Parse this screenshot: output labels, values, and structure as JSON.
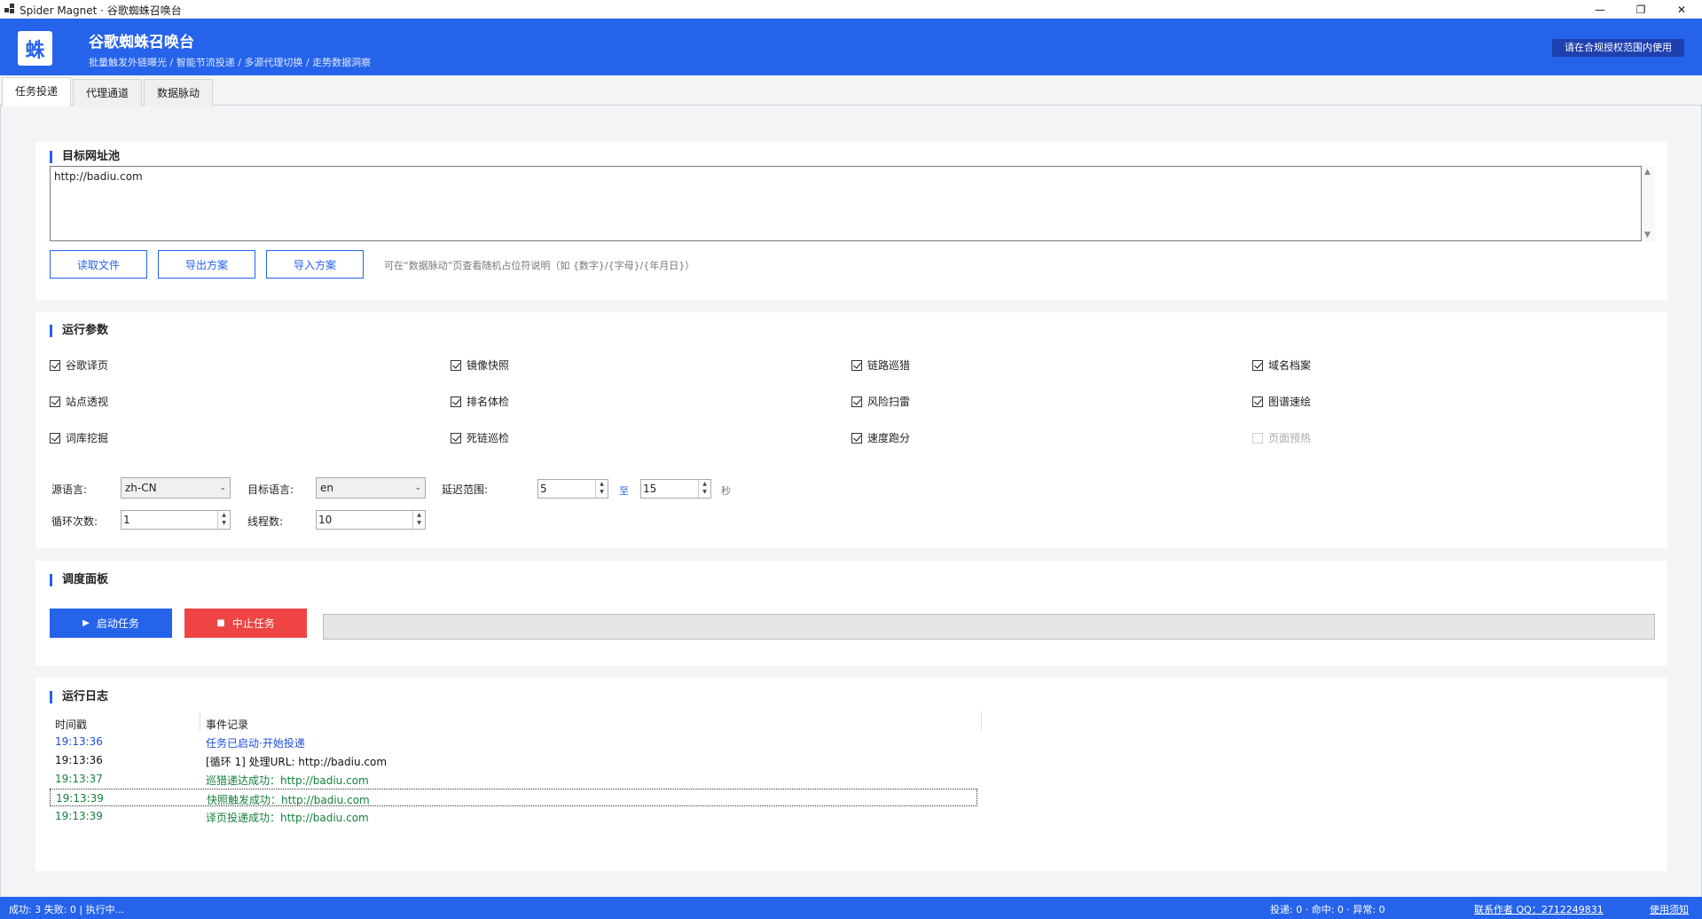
{
  "window": {
    "title": "Spider Magnet · 谷歌蜘蛛召唤台",
    "controls": {
      "minimize": "—",
      "restore": "❐",
      "close": "✕"
    }
  },
  "header": {
    "logo": "蛛",
    "title": "谷歌蜘蛛召唤台",
    "subtitle": "批量触发外链曝光 / 智能节流投递 / 多源代理切换 / 走势数据洞察",
    "notice": "请在合规授权范围内使用"
  },
  "tabs": [
    {
      "label": "任务投递",
      "active": true
    },
    {
      "label": "代理通道",
      "active": false
    },
    {
      "label": "数据脉动",
      "active": false
    }
  ],
  "url_pool": {
    "title": "目标网址池",
    "value": "http://badiu.com",
    "buttons": {
      "read_file": "读取文件",
      "export": "导出方案",
      "import": "导入方案"
    },
    "hint": "可在“数据脉动”页查看随机占位符说明（如 {数字}/{字母}/{年月日}）"
  },
  "params": {
    "title": "运行参数",
    "checkboxes": [
      {
        "label": "谷歌译页",
        "checked": true
      },
      {
        "label": "镜像快照",
        "checked": true
      },
      {
        "label": "链路巡猎",
        "checked": true
      },
      {
        "label": "域名档案",
        "checked": true
      },
      {
        "label": "站点透视",
        "checked": true
      },
      {
        "label": "排名体检",
        "checked": true
      },
      {
        "label": "风险扫雷",
        "checked": true
      },
      {
        "label": "图谱速绘",
        "checked": true
      },
      {
        "label": "词库挖掘",
        "checked": true
      },
      {
        "label": "死链巡检",
        "checked": true
      },
      {
        "label": "速度跑分",
        "checked": true
      },
      {
        "label": "页面预热",
        "checked": false,
        "disabled": true
      }
    ],
    "source_lang_label": "源语言:",
    "source_lang": "zh-CN",
    "target_lang_label": "目标语言:",
    "target_lang": "en",
    "delay_label": "延迟范围:",
    "delay_min": "5",
    "delay_to": "至",
    "delay_max": "15",
    "delay_unit": "秒",
    "loop_label": "循环次数:",
    "loop_count": "1",
    "thread_label": "线程数:",
    "thread_count": "10"
  },
  "dispatch": {
    "title": "调度面板",
    "start_icon": "▶",
    "start_label": "启动任务",
    "stop_icon": "■",
    "stop_label": "中止任务",
    "progress": 0
  },
  "log": {
    "title": "运行日志",
    "columns": {
      "time": "时间戳",
      "event": "事件记录"
    },
    "rows": [
      {
        "time": "19:13:36",
        "event": "任务已启动·开始投递",
        "color": "#1d4ed8"
      },
      {
        "time": "19:13:36",
        "event": "[循环 1] 处理URL: http://badiu.com",
        "color": "#111111"
      },
      {
        "time": "19:13:37",
        "event": "巡猎递达成功：http://badiu.com",
        "color": "#15803d"
      },
      {
        "time": "19:13:39",
        "event": "快照触发成功：http://badiu.com",
        "color": "#15803d"
      },
      {
        "time": "19:13:39",
        "event": "译页投递成功：http://badiu.com",
        "color": "#15803d"
      }
    ]
  },
  "status": {
    "left": "成功: 3  失败: 0  |  执行中...",
    "right": "投递: 0  ·  命中: 0  ·  异常: 0",
    "contact": "联系作者 QQ：2712249831",
    "guide": "使用须知"
  }
}
